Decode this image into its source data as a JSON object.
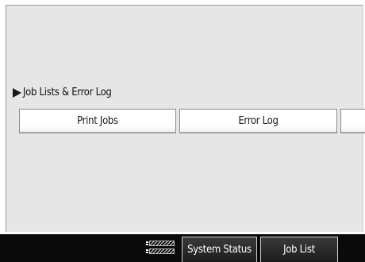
{
  "section": {
    "title": "Job Lists & Error Log"
  },
  "buttons": {
    "print_jobs": "Print Jobs",
    "error_log": "Error Log",
    "more": ""
  },
  "taskbar": {
    "system_status": "System Status",
    "job_list": "Job List"
  },
  "icons": {
    "section_arrow": "right-triangle-icon",
    "status_indicator": "status-indicator-icon"
  },
  "colors": {
    "panel_background": "#e6e6e6",
    "taskbar_background": "#0a0a0a",
    "button_background": "#ffffff"
  }
}
